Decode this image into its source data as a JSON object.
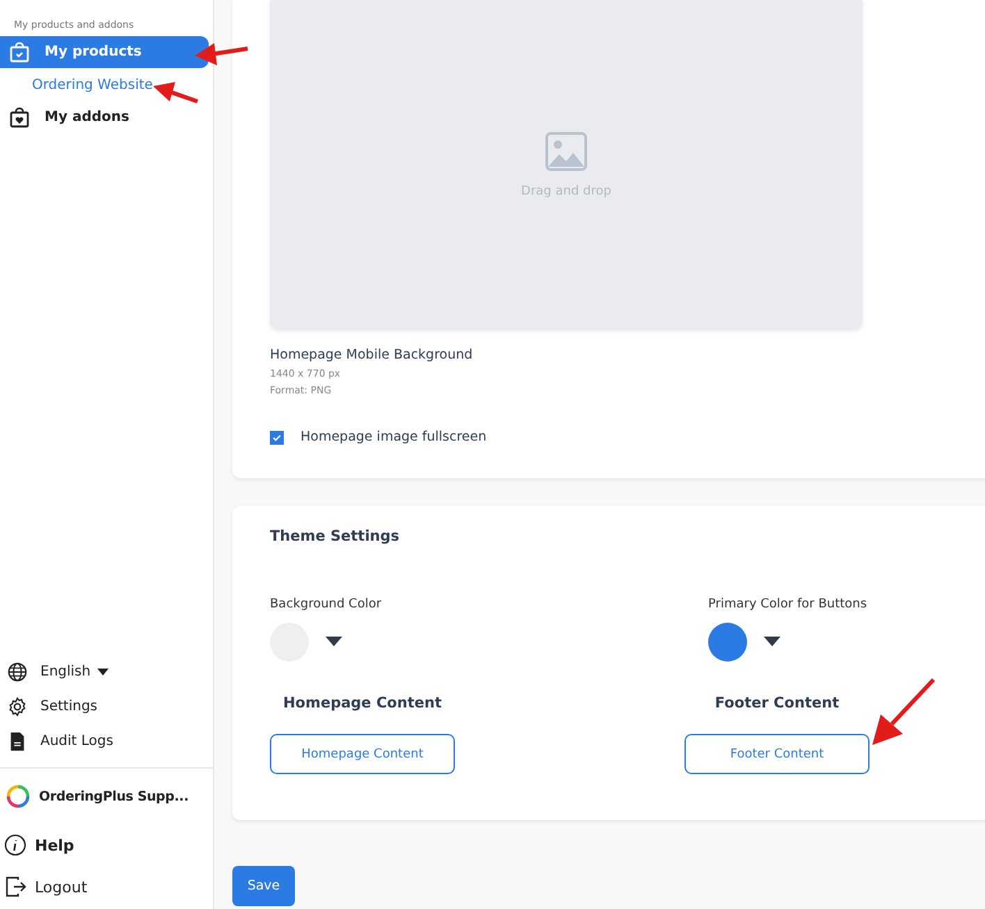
{
  "sidebar": {
    "section_label": "My products and addons",
    "items": [
      {
        "label": "My products",
        "kind": "products",
        "selected": true
      },
      {
        "label": "Ordering Website",
        "kind": "sub",
        "selected": false
      },
      {
        "label": "My addons",
        "kind": "addons",
        "selected": false
      }
    ],
    "bottom_items": [
      {
        "label": "English",
        "kind": "language"
      },
      {
        "label": "Settings",
        "kind": "settings"
      },
      {
        "label": "Audit Logs",
        "kind": "logs"
      }
    ],
    "support": "OrderingPlus Supp...",
    "help": "Help",
    "logout": "Logout"
  },
  "upload": {
    "hint": "Drag and drop",
    "title": "Homepage Mobile Background",
    "size": "1440 x 770 px",
    "format": "Format: PNG",
    "fullscreen": {
      "label": "Homepage image fullscreen",
      "checked": true
    }
  },
  "theme": {
    "title": "Theme Settings",
    "colors": [
      {
        "label": "Background Color",
        "color": "#f0eeee"
      },
      {
        "label": "Primary Color for Buttons",
        "color": "#2c7be5"
      }
    ],
    "contents": [
      {
        "heading": "Homepage Content",
        "button": "Homepage Content"
      },
      {
        "heading": "Footer Content",
        "button": "Footer Content"
      }
    ]
  },
  "save": "Save"
}
